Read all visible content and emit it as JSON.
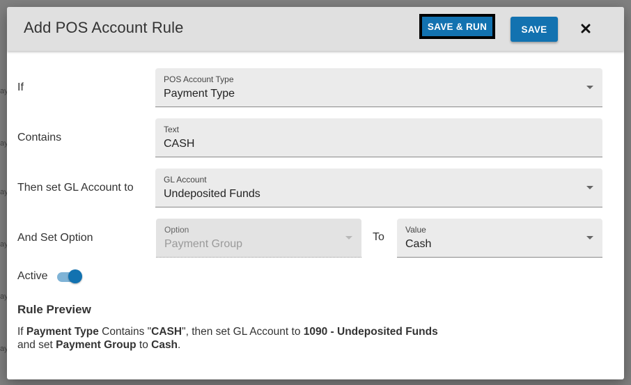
{
  "modal": {
    "title": "Add POS Account Rule",
    "buttons": {
      "save_run": "SAVE & RUN",
      "save": "SAVE"
    },
    "close_icon": "close-icon"
  },
  "form": {
    "if": {
      "row_label": "If",
      "field_label": "POS Account Type",
      "value": "Payment Type"
    },
    "contains": {
      "row_label": "Contains",
      "field_label": "Text",
      "value": "CASH"
    },
    "gl_account": {
      "row_label": "Then set GL Account to",
      "field_label": "GL Account",
      "value": "Undeposited Funds"
    },
    "set_option": {
      "row_label": "And Set Option",
      "option_label": "Option",
      "option_value": "Payment Group",
      "to_label": "To",
      "value_label": "Value",
      "value_value": "Cash"
    },
    "active": {
      "label": "Active",
      "checked": true
    }
  },
  "preview": {
    "title": "Rule Preview",
    "line1": {
      "p1": "If ",
      "b1": "Payment Type",
      "p2": " Contains \"",
      "b2": "CASH",
      "p3": "\", then set GL Account to ",
      "b3": "1090 - Undeposited Funds"
    },
    "line2": {
      "p1": "and set ",
      "b1": "Payment Group",
      "p2": " to ",
      "b2": "Cash",
      "p3": "."
    }
  },
  "background": {
    "row_hint": "ay"
  },
  "colors": {
    "primary": "#1272b0",
    "toggle_track": "#7fb3d6",
    "header_bg": "#e0e0e0",
    "field_bg": "#ebebeb"
  }
}
